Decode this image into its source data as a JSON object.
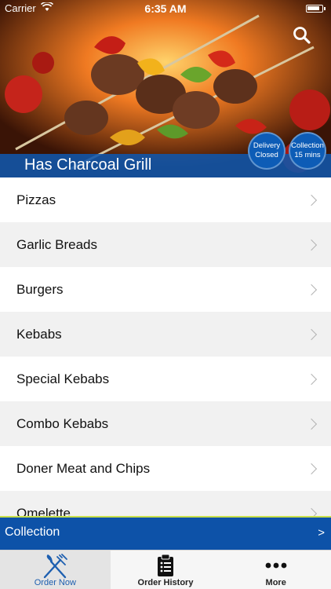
{
  "status_bar": {
    "carrier": "Carrier",
    "time": "6:35 AM"
  },
  "header": {
    "restaurant_name": "Has Charcoal Grill",
    "delivery_badge": {
      "line1": "Delivery",
      "line2": "Closed"
    },
    "collection_badge": {
      "line1": "Collection",
      "line2": "15 mins"
    },
    "search_icon": "search-icon"
  },
  "menu": {
    "items": [
      {
        "label": "Pizzas"
      },
      {
        "label": "Garlic Breads"
      },
      {
        "label": "Burgers"
      },
      {
        "label": "Kebabs"
      },
      {
        "label": "Special Kebabs"
      },
      {
        "label": "Combo Kebabs"
      },
      {
        "label": "Doner Meat and Chips"
      },
      {
        "label": "Omelette"
      }
    ]
  },
  "order_bar": {
    "label": "Collection",
    "arrow": ">"
  },
  "tabs": [
    {
      "label": "Order Now",
      "icon": "fork-knife-icon",
      "active": true
    },
    {
      "label": "Order History",
      "icon": "clipboard-icon",
      "active": false
    },
    {
      "label": "More",
      "icon": "more-dots-icon",
      "active": false
    }
  ],
  "colors": {
    "brand_blue": "#0d52a8",
    "accent_lime": "#c8e04a",
    "active_tab": "#1d5fb0"
  }
}
